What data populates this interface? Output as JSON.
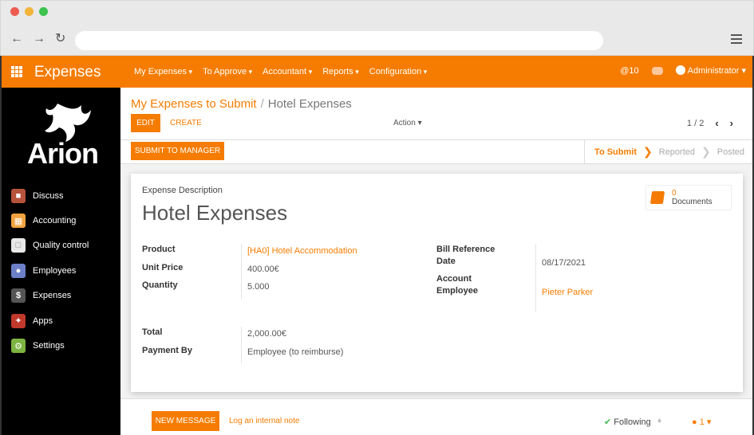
{
  "app": {
    "title": "Expenses",
    "menu": [
      "My Expenses",
      "To Approve",
      "Accountant",
      "Reports",
      "Configuration"
    ],
    "activity_count": "@10",
    "user": "Administrator",
    "accent_color": "#f57c00"
  },
  "sidebar": {
    "logo_text": "Arion",
    "items": [
      {
        "label": "Discuss",
        "icon": "chat-icon",
        "color": "#b5533c"
      },
      {
        "label": "Accounting",
        "icon": "accounting-icon",
        "color": "#f1a340"
      },
      {
        "label": "Quality control",
        "icon": "quality-icon",
        "color": "#e8e8e8"
      },
      {
        "label": "Employees",
        "icon": "employees-icon",
        "color": "#6c7fc8"
      },
      {
        "label": "Expenses",
        "icon": "dollar-icon",
        "color": "#555555"
      },
      {
        "label": "Apps",
        "icon": "apps-icon",
        "color": "#c0392b"
      },
      {
        "label": "Settings",
        "icon": "gear-icon",
        "color": "#7cb342"
      }
    ]
  },
  "breadcrumb": {
    "parent": "My Expenses to Submit",
    "current": "Hotel Expenses"
  },
  "toolbar": {
    "edit": "EDIT",
    "create": "CREATE",
    "action": "Action",
    "pager": "1 / 2"
  },
  "status": {
    "submit_button": "SUBMIT TO MANAGER",
    "stages": [
      "To Submit",
      "Reported",
      "Posted"
    ],
    "active_stage": "To Submit"
  },
  "form": {
    "desc_label": "Expense Description",
    "title": "Hotel Expenses",
    "documents_count": "0",
    "documents_label": "Documents",
    "product_label": "Product",
    "product_value": "[HA0] Hotel Accommodation",
    "unit_price_label": "Unit Price",
    "unit_price_value": "400.00€",
    "quantity_label": "Quantity",
    "quantity_value": "5.000",
    "bill_ref_label": "Bill Reference",
    "date_label": "Date",
    "date_value": "08/17/2021",
    "account_label": "Account",
    "employee_label": "Employee",
    "employee_value": "Pieter Parker",
    "total_label": "Total",
    "total_value": "2,000.00€",
    "payment_label": "Payment By",
    "payment_value": "Employee (to reimburse)"
  },
  "chatter": {
    "new_message": "NEW MESSAGE",
    "log_note": "Log an internal note",
    "following": "Following",
    "followers": "1"
  }
}
